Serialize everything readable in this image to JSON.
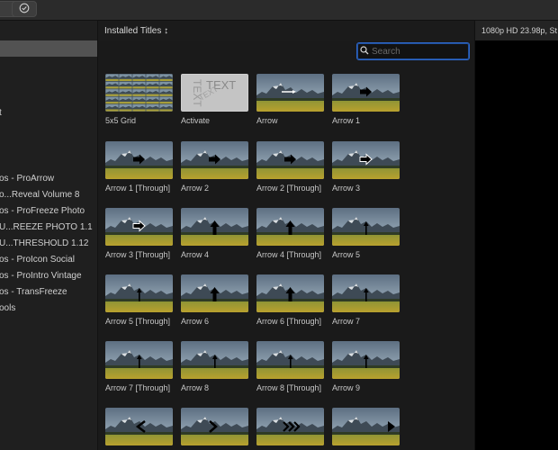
{
  "browser": {
    "title": "Installed Titles ↕",
    "search": {
      "placeholder": "Search",
      "value": ""
    }
  },
  "viewer": {
    "info": "1080p HD 23.98p, St"
  },
  "sidebar": {
    "items": [
      {
        "label": "t"
      },
      {
        "label": "os - ProArrow"
      },
      {
        "label": "o...Reveal Volume 8"
      },
      {
        "label": "os - ProFreeze Photo"
      },
      {
        "label": "U...REEZE PHOTO 1.1"
      },
      {
        "label": "U...THRESHOLD 1.12"
      },
      {
        "label": "os - ProIcon Social"
      },
      {
        "label": "os - ProIntro Vintage"
      },
      {
        "label": "os - TransFreeze"
      },
      {
        "label": "ools"
      }
    ]
  },
  "titles": [
    {
      "label": "5x5 Grid",
      "thumb": "grid"
    },
    {
      "label": "Activate",
      "thumb": "text"
    },
    {
      "label": "Arrow",
      "thumb": "line"
    },
    {
      "label": "Arrow 1",
      "thumb": "arrow-right"
    },
    {
      "label": "Arrow 1 [Through]",
      "thumb": "arrow-right"
    },
    {
      "label": "Arrow 2",
      "thumb": "arrow-right"
    },
    {
      "label": "Arrow 2 [Through]",
      "thumb": "arrow-right"
    },
    {
      "label": "Arrow 3",
      "thumb": "arrow-outline"
    },
    {
      "label": "Arrow 3 [Through]",
      "thumb": "arrow-outline"
    },
    {
      "label": "Arrow 4",
      "thumb": "arrow-up"
    },
    {
      "label": "Arrow 4 [Through]",
      "thumb": "arrow-up"
    },
    {
      "label": "Arrow 5",
      "thumb": "arrow-up-thin"
    },
    {
      "label": "Arrow 5 [Through]",
      "thumb": "arrow-up-thin"
    },
    {
      "label": "Arrow 6",
      "thumb": "arrow-up"
    },
    {
      "label": "Arrow 6 [Through]",
      "thumb": "arrow-up"
    },
    {
      "label": "Arrow 7",
      "thumb": "arrow-up-thin"
    },
    {
      "label": "Arrow 7 [Through]",
      "thumb": "arrow-up-thin"
    },
    {
      "label": "Arrow 8",
      "thumb": "arrow-up-thin"
    },
    {
      "label": "Arrow 8 [Through]",
      "thumb": "arrow-up-thin"
    },
    {
      "label": "Arrow 9",
      "thumb": "arrow-up-thin"
    },
    {
      "label": "",
      "thumb": "chevron-left"
    },
    {
      "label": "",
      "thumb": "chevron-right"
    },
    {
      "label": "",
      "thumb": "chevrons"
    },
    {
      "label": "",
      "thumb": "play"
    }
  ]
}
